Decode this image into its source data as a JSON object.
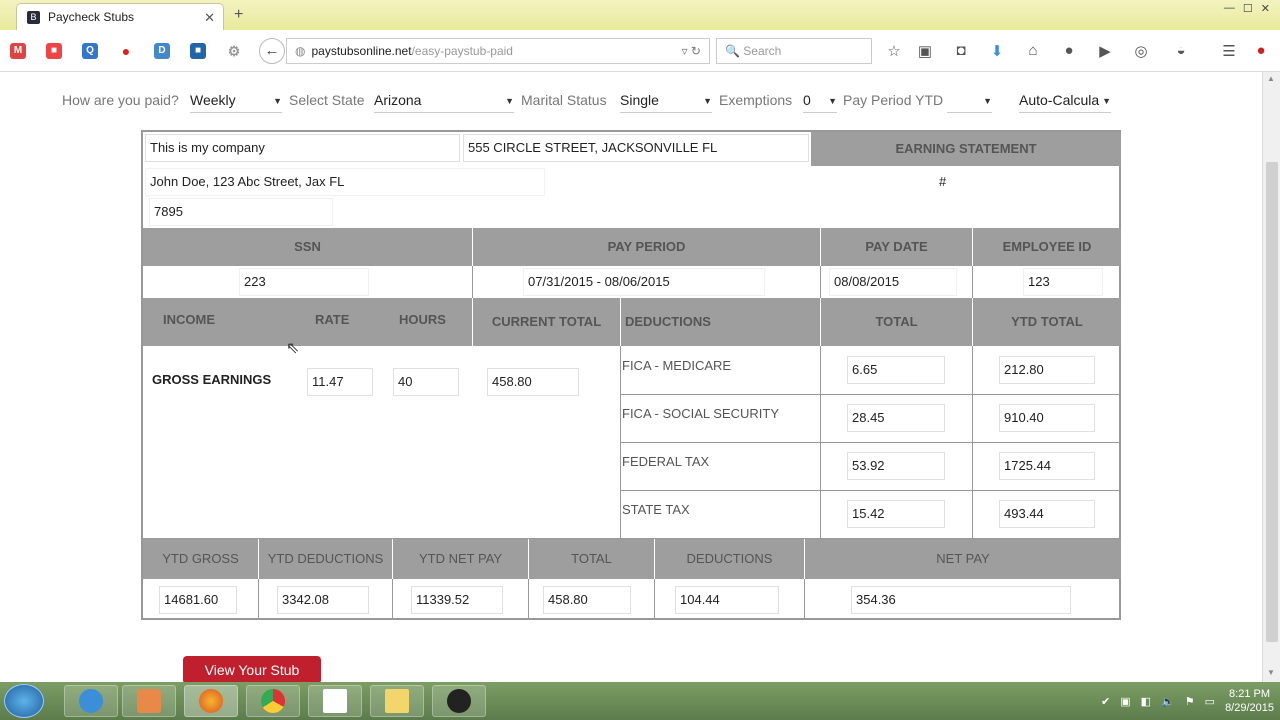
{
  "browser": {
    "tab_title": "Paycheck Stubs",
    "url_host": "paystubsonline.net",
    "url_path": "/easy-paystub-paid",
    "search_placeholder": "Search"
  },
  "controls": {
    "paid_label": "How are you paid?",
    "paid_value": "Weekly",
    "state_label": "Select State",
    "state_value": "Arizona",
    "marital_label": "Marital Status",
    "marital_value": "Single",
    "exemptions_label": "Exemptions",
    "exemptions_value": "0",
    "pay_period_label": "Pay Period YTD",
    "pay_period_value": "",
    "auto_value": "Auto-Calcula"
  },
  "stub": {
    "company": "This is my company",
    "company_address": "555 CIRCLE STREET, JACKSONVILLE FL",
    "earning_statement": "EARNING STATEMENT",
    "employee": "John Doe, 123 Abc Street, Jax FL",
    "hash": "#",
    "check_number": "7895",
    "headers": {
      "ssn": "SSN",
      "pay_period": "PAY PERIOD",
      "pay_date": "PAY DATE",
      "employee_id": "EMPLOYEE ID"
    },
    "ssn": "223",
    "pay_period": "07/31/2015 - 08/06/2015",
    "pay_date": "08/08/2015",
    "employee_id": "123",
    "income_headers": {
      "income": "INCOME",
      "rate": "RATE",
      "hours": "HOURS",
      "current_total": "CURRENT TOTAL",
      "deductions": "DEDUCTIONS",
      "total": "TOTAL",
      "ytd_total": "YTD TOTAL"
    },
    "gross_earnings_label": "GROSS EARNINGS",
    "rate": "11.47",
    "hours": "40",
    "current_total": "458.80",
    "deductions": [
      {
        "name": "FICA - MEDICARE",
        "total": "6.65",
        "ytd": "212.80"
      },
      {
        "name": "FICA - SOCIAL SECURITY",
        "total": "28.45",
        "ytd": "910.40"
      },
      {
        "name": "FEDERAL TAX",
        "total": "53.92",
        "ytd": "1725.44"
      },
      {
        "name": "STATE TAX",
        "total": "15.42",
        "ytd": "493.44"
      }
    ],
    "summary_headers": {
      "ytd_gross": "YTD GROSS",
      "ytd_deductions": "YTD DEDUCTIONS",
      "ytd_net_pay": "YTD NET PAY",
      "total": "TOTAL",
      "deductions": "DEDUCTIONS",
      "net_pay": "NET PAY"
    },
    "summary": {
      "ytd_gross": "14681.60",
      "ytd_deductions": "3342.08",
      "ytd_net_pay": "11339.52",
      "total": "458.80",
      "deductions": "104.44",
      "net_pay": "354.36"
    }
  },
  "view_button": "View Your Stub",
  "taskbar": {
    "time": "8:21 PM",
    "date": "8/29/2015"
  },
  "colors": {
    "header_gray": "#9e9e9e",
    "button_red": "#c0202e"
  }
}
